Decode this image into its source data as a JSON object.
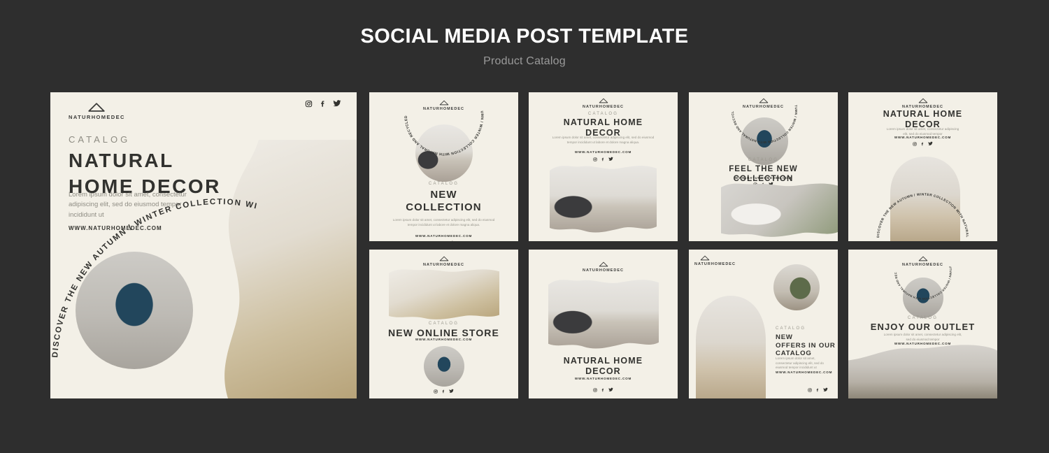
{
  "header": {
    "title": "SOCIAL MEDIA POST TEMPLATE",
    "subtitle": "Product Catalog"
  },
  "brand": {
    "name": "NATURHOMEDEC",
    "url": "WWW.NATURHOMEDEC.COM",
    "logo_icon": "house-arch-icon",
    "colors": {
      "page_background": "#2e2e2e",
      "card_background": "#f3f0e7",
      "heading_text": "#32322f",
      "muted_text": "#97958c",
      "accent_blue": "#22465c"
    }
  },
  "social": {
    "instagram": "instagram-icon",
    "facebook": "facebook-icon",
    "twitter": "twitter-icon"
  },
  "strings": {
    "catalog": "CATALOG",
    "lorem_short": "Lorem ipsum dolor sit amet, consectetur adipiscing elit, sed do eiusmod tempor incididunt ut",
    "lorem_long": "Lorem ipsum dolor sit amet, consectetur adipiscing elit, sed do eiusmod tempor incididunt ut labore et dolore magna aliqua.",
    "lorem_mid": "Lorem ipsum dolor sit amet, consectetur adipiscing elit, sed do eiusmod tempor",
    "arc_text": "DISCOVER THE NEW AUTUMN / WINTER COLLECTION WITH NATURAL AND RECYCLED MATERIALS"
  },
  "hero": {
    "eyebrow": "CATALOG",
    "title_line1": "NATURAL",
    "title_line2": "HOME DECOR",
    "body": "Lorem ipsum dolor sit amet, consectetur adipiscing elit, sed do eiusmod tempor incididunt ut",
    "url": "WWW.NATURHOMEDEC.COM",
    "arc_text": "DISCOVER THE NEW AUTUMN / WINTER COLLECTION WITH NATURAL AND RECYCLED MATERIALS",
    "circle_photo": "blue-velvet-armchair-photo",
    "side_photo": "pampas-grass-vase-photo"
  },
  "cards": [
    {
      "id": "new-collection",
      "eyebrow": "CATALOG",
      "title_line1": "NEW",
      "title_line2": "COLLECTION",
      "body": "Lorem ipsum dolor sit amet, consectetur adipiscing elit, sed do eiusmod tempor incididunt ut labore et dolore magna aliqua.",
      "url": "WWW.NATURHOMEDEC.COM",
      "arc_text": "DISCOVER THE NEW AUTUMN / WINTER COLLECTION WITH NATURAL AND RECYCLED MATERIALS",
      "photo": "sofa-with-plant-basket-photo"
    },
    {
      "id": "natural-home-decor-a",
      "eyebrow": "CATALOG",
      "title_line1": "NATURAL HOME",
      "title_line2": "DECOR",
      "body": "Lorem ipsum dolor sit amet, consectetur adipiscing elit, sed do eiusmod tempor incididunt ut labore et dolore magna aliqua.",
      "url": "WWW.NATURHOMEDEC.COM",
      "photo": "living-room-fireplace-photo"
    },
    {
      "id": "feel-the-new-collection",
      "eyebrow": "CATALOG",
      "title_line1": "FEEL THE NEW",
      "title_line2": "COLLECTION",
      "url": "WWW.NATURHOMEDEC.COM",
      "arc_text": "DISCOVER THE NEW AUTUMN / WINTER COLLECTION WITH NATURAL AND RECYCLED MATERIALS",
      "photo": "blue-velvet-armchair-photo",
      "photo2": "cushion-and-plant-photo"
    },
    {
      "id": "natural-home-decor-arch",
      "title_line1": "NATURAL HOME",
      "title_line2": "DECOR",
      "body": "Lorem ipsum dolor sit amet, consectetur adipiscing elit, sed do eiusmod tempor",
      "url": "WWW.NATURHOMEDEC.COM",
      "arc_text": "DISCOVER THE NEW AUTUMN / WINTER COLLECTION WITH NATURAL AND RECYCLED MATERIALS",
      "photo": "papasan-chair-room-photo"
    },
    {
      "id": "new-online-store",
      "eyebrow": "CATALOG",
      "title_line1": "NEW ONLINE STORE",
      "url": "WWW.NATURHOMEDEC.COM",
      "photo": "papasan-chair-room-photo",
      "photo2": "blue-velvet-armchair-photo"
    },
    {
      "id": "natural-home-decor-b",
      "title_line1": "NATURAL HOME",
      "title_line2": "DECOR",
      "url": "WWW.NATURHOMEDEC.COM",
      "photo": "living-room-fireplace-photo"
    },
    {
      "id": "new-offers-in-our-catalog",
      "eyebrow": "CATALOG",
      "title_line1": "NEW",
      "title_line2": "OFFERS IN OUR",
      "title_line3": "CATALOG",
      "body": "Lorem ipsum dolor sit amet, consectetur adipiscing elit, sed do eiusmod tempor incididunt ut",
      "url": "WWW.NATURHOMEDEC.COM",
      "photo": "papasan-chair-room-photo",
      "photo2": "potted-plant-basket-photo"
    },
    {
      "id": "enjoy-our-outlet",
      "eyebrow": "CATALOG",
      "title_line1": "ENJOY OUR OUTLET",
      "body": "Lorem ipsum dolor sit amet, consectetur adipiscing elit, sed do eiusmod tempor",
      "url": "WWW.NATURHOMEDEC.COM",
      "arc_text": "DISCOVER THE NEW AUTUMN / WINTER COLLECTION WITH NATURAL AND RECYCLED MATERIALS",
      "photo": "blue-velvet-armchair-photo",
      "photo2": "bedroom-plant-photo"
    }
  ]
}
